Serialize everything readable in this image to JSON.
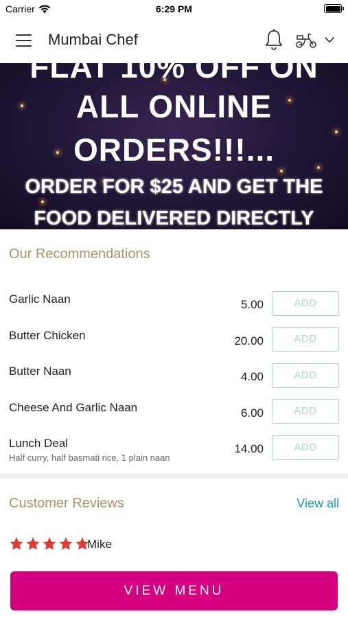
{
  "status_bar": {
    "carrier": "Carrier",
    "time": "6:29 PM",
    "icons": [
      "wifi-icon",
      "battery-icon"
    ]
  },
  "header": {
    "title": "Mumbai Chef",
    "icons": [
      "menu-icon",
      "bell-icon",
      "delivery-scooter-icon",
      "chevron-down-icon"
    ]
  },
  "banner": {
    "line1": "FLAT 10% OFF ON",
    "line2": "ALL ONLINE",
    "line3": "ORDERS!!!...",
    "line4": "ORDER FOR $25 AND GET THE",
    "line5": "FOOD DELIVERED DIRECTLY"
  },
  "recommendations": {
    "title": "Our Recommendations",
    "add_label": "ADD",
    "items": [
      {
        "name": "Garlic Naan",
        "description": "",
        "price": "5.00"
      },
      {
        "name": "Butter Chicken",
        "description": "",
        "price": "20.00"
      },
      {
        "name": "Butter Naan",
        "description": "",
        "price": "4.00"
      },
      {
        "name": "Cheese And Garlic Naan",
        "description": "",
        "price": "6.00"
      },
      {
        "name": "Lunch Deal",
        "description": "Half curry, half basmati rice, 1 plain naan",
        "price": "14.00"
      }
    ]
  },
  "reviews": {
    "title": "Customer Reviews",
    "view_all": "View all",
    "items": [
      {
        "reviewer": "Mike",
        "rating": 5
      }
    ]
  },
  "footer": {
    "view_menu": "VIEW MENU"
  },
  "colors": {
    "accent": "#d5007f",
    "section_title": "#a8936b",
    "add_button": "#a9dbc3",
    "link": "#1a9bc4",
    "star": "#e03a35"
  }
}
